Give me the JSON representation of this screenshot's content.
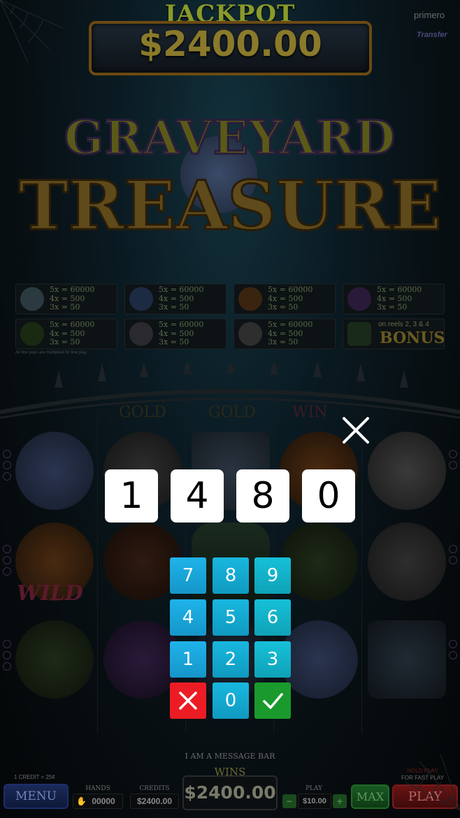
{
  "jackpot": {
    "label": "JACKPOT",
    "amount": "$2400.00"
  },
  "brand": {
    "primero": "primero",
    "transfer": "Transfer"
  },
  "game_title": {
    "line1": "GRAVEYARD",
    "line2": "TREASURE"
  },
  "paytable": {
    "rows": [
      {
        "five": "5x = 60000",
        "four": "4x = 500",
        "three": "3x = 50"
      },
      {
        "five": "5x = 60000",
        "four": "4x = 500",
        "three": "3x = 50"
      },
      {
        "five": "5x = 60000",
        "four": "4x = 500",
        "three": "3x = 50"
      },
      {
        "five": "5x = 60000",
        "four": "4x = 500",
        "three": "3x = 50"
      },
      {
        "five": "5x = 60000",
        "four": "4x = 500",
        "three": "3x = 50"
      },
      {
        "five": "5x = 60000",
        "four": "4x = 500",
        "three": "3x = 50"
      },
      {
        "five": "5x = 60000",
        "four": "4x = 500",
        "three": "3x = 50"
      }
    ],
    "bonus_note": "on reels 2, 3 & 4",
    "bonus_label": "BONUS",
    "note": "All line pays are multiplied for line play."
  },
  "reel_symbols": {
    "wild": "WILD",
    "reel_top_labels": [
      "GOLD",
      "GOLD",
      "WIN"
    ]
  },
  "overlay": {
    "digits": [
      "1",
      "4",
      "8",
      "0"
    ],
    "keys": [
      "7",
      "8",
      "9",
      "4",
      "5",
      "6",
      "1",
      "2",
      "3",
      "0"
    ]
  },
  "bottom": {
    "message": "I AM A MESSAGE BAR",
    "wins_label": "WINS",
    "credit_rate": "1 CREDIT = 25¢",
    "hold_hint_1": "HOLD",
    "hold_hint_play": "PLAY",
    "hold_hint_2": "FOR FAST PLAY",
    "menu": "MENU",
    "hands_label": "HANDS",
    "hands_value": "00000",
    "credits_label": "CREDITS",
    "credits_value": "$2400.00",
    "win_amount": "$2400.00",
    "play_label": "PLAY",
    "bet_value": "$10.00",
    "minus": "−",
    "plus": "+",
    "max": "MAX",
    "play": "PLAY"
  },
  "colors": {
    "key_blue": "#1fb3ea",
    "key_cancel": "#ec1c24",
    "key_ok": "#1a9a2c",
    "tile": "#ffffff"
  }
}
